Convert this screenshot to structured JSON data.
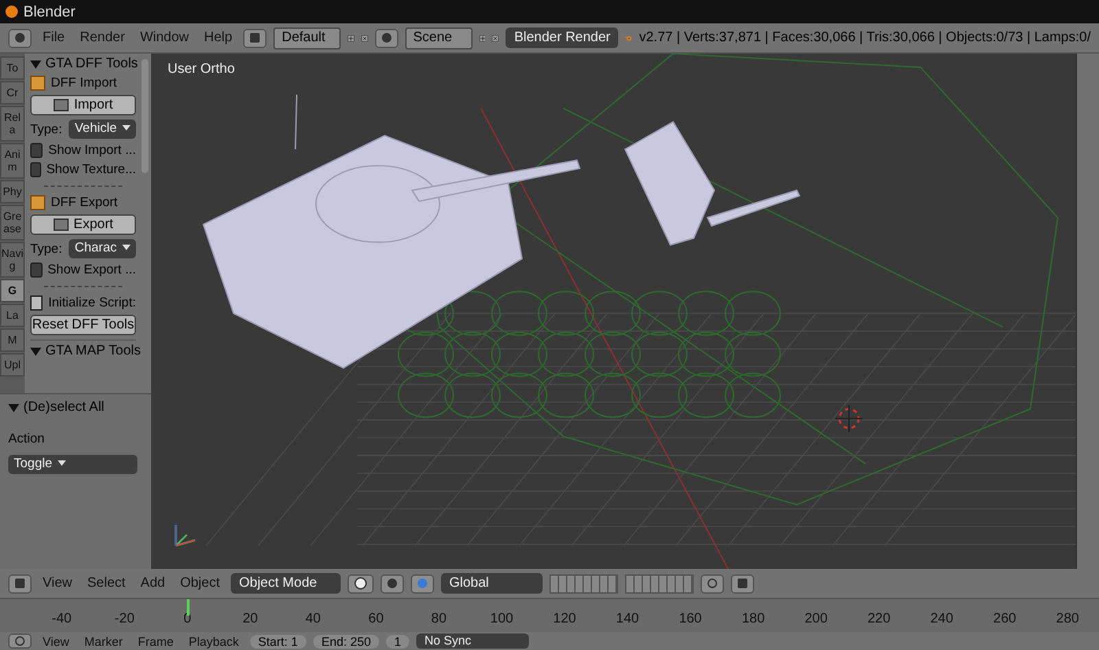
{
  "window": {
    "title": "Blender"
  },
  "info_header": {
    "menus": [
      "File",
      "Render",
      "Window",
      "Help"
    ],
    "layout": "Default",
    "scene": "Scene",
    "engine": "Blender Render",
    "stats": "v2.77 | Verts:37,871 | Faces:30,066 | Tris:30,066 | Objects:0/73 | Lamps:0/"
  },
  "tool_tabs": [
    {
      "label": "To",
      "selected": false
    },
    {
      "label": "Cr",
      "selected": false
    },
    {
      "label": "Rela",
      "selected": false
    },
    {
      "label": "Anim",
      "selected": false
    },
    {
      "label": "Phy",
      "selected": false
    },
    {
      "label": "Grease",
      "selected": false
    },
    {
      "label": "Navig",
      "selected": false
    },
    {
      "label": "G",
      "selected": true
    },
    {
      "label": "La",
      "selected": false
    },
    {
      "label": "M",
      "selected": false
    },
    {
      "label": "Upl",
      "selected": false
    }
  ],
  "tool_panel": {
    "title": "GTA DFF Tools",
    "expanded": true,
    "sections": [
      {
        "heading": "DFF Import",
        "button": "Import",
        "type_label": "Type:",
        "type_value": "Vehicle",
        "checkboxes": [
          {
            "label": "Show Import ...",
            "checked": false
          },
          {
            "label": "Show Texture...",
            "checked": false
          }
        ]
      },
      {
        "heading": "DFF Export",
        "button": "Export",
        "type_label": "Type:",
        "type_value": "Charac",
        "checkboxes": [
          {
            "label": "Show Export ...",
            "checked": false
          }
        ]
      }
    ],
    "init_label": "Initialize Script:",
    "reset_button": "Reset DFF Tools",
    "next_panel": {
      "title": "GTA MAP Tools",
      "expanded": true
    }
  },
  "operator_panel": {
    "title": "(De)select All",
    "expanded": true,
    "field_label": "Action",
    "value": "Toggle"
  },
  "viewport": {
    "label": "User Ortho"
  },
  "view3d_header": {
    "menus": [
      "View",
      "Select",
      "Add",
      "Object"
    ],
    "mode": "Object Mode",
    "orientation": "Global"
  },
  "timeline": {
    "ticks": [
      {
        "label": "-40",
        "current": false
      },
      {
        "label": "-20",
        "current": false
      },
      {
        "label": "0",
        "current": true
      },
      {
        "label": "20",
        "current": false
      },
      {
        "label": "40",
        "current": false
      },
      {
        "label": "60",
        "current": false
      },
      {
        "label": "80",
        "current": false
      },
      {
        "label": "100",
        "current": false
      },
      {
        "label": "120",
        "current": false
      },
      {
        "label": "140",
        "current": false
      },
      {
        "label": "160",
        "current": false
      },
      {
        "label": "180",
        "current": false
      },
      {
        "label": "200",
        "current": false
      },
      {
        "label": "220",
        "current": false
      },
      {
        "label": "240",
        "current": false
      },
      {
        "label": "260",
        "current": false
      },
      {
        "label": "280",
        "current": false
      }
    ]
  },
  "timeline_header": {
    "menus": [
      "View",
      "Marker",
      "Frame",
      "Playback"
    ],
    "start_label": "Start:",
    "start": "1",
    "end_label": "End:",
    "end": "250",
    "frame": "1",
    "sync": "No Sync"
  }
}
